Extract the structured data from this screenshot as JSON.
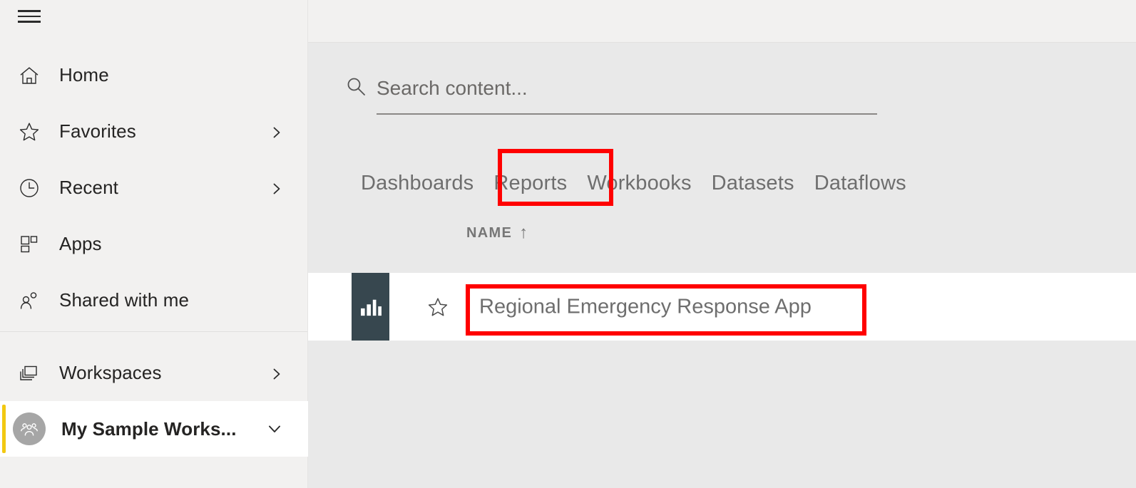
{
  "app": {
    "title": "Power BI Service Content List"
  },
  "sidebar": {
    "menu_icon": "hamburger-menu-icon",
    "items": [
      {
        "label": "Home",
        "icon": "home-icon",
        "chevron": false
      },
      {
        "label": "Favorites",
        "icon": "star-icon",
        "chevron": true
      },
      {
        "label": "Recent",
        "icon": "clock-icon",
        "chevron": true
      },
      {
        "label": "Apps",
        "icon": "apps-grid-icon",
        "chevron": false
      },
      {
        "label": "Shared with me",
        "icon": "people-icon",
        "chevron": false
      }
    ],
    "lower_items": [
      {
        "label": "Workspaces",
        "icon": "workspaces-stack-icon",
        "chevron": true
      }
    ],
    "workspace": {
      "label": "My Sample Works...",
      "avatar_icon": "group-avatar-icon",
      "chevron_icon": "chevron-down-icon",
      "selected": true,
      "indicator_color": "#f2c811"
    }
  },
  "search": {
    "icon": "search-icon",
    "placeholder": "Search content...",
    "value": ""
  },
  "tabs": {
    "items": [
      {
        "label": "Dashboards",
        "active": false
      },
      {
        "label": "Reports",
        "active": true
      },
      {
        "label": "Workbooks",
        "active": false
      },
      {
        "label": "Datasets",
        "active": false
      },
      {
        "label": "Dataflows",
        "active": false
      }
    ],
    "highlight_color": "#ff0000",
    "highlighted": "Reports"
  },
  "table": {
    "columns": [
      {
        "label": "NAME",
        "sort": "↑",
        "sort_direction": "ascending"
      }
    ],
    "rows": [
      {
        "tile_icon": "report-bar-chart-icon",
        "tile_color": "#37474f",
        "favorite_icon": "star-outline-icon",
        "favorited": false,
        "name": "Regional Emergency Response App",
        "highlighted": true
      }
    ]
  },
  "annotations": {
    "highlight_color": "#ff0000",
    "boxes": [
      "Reports",
      "Regional Emergency Response App"
    ]
  }
}
